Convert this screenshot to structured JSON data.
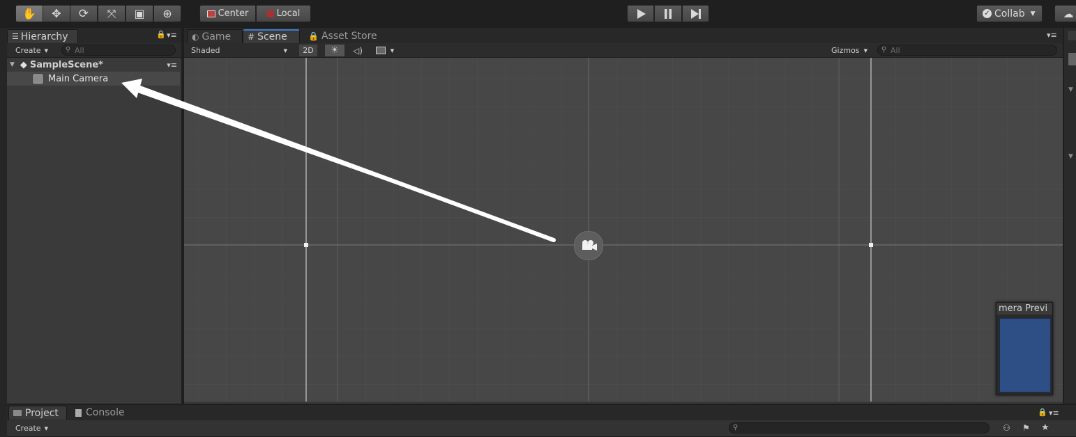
{
  "toolbar": {
    "tools": [
      {
        "icon": "hand-tool-icon",
        "glyph": "✋"
      },
      {
        "icon": "move-tool-icon",
        "glyph": "✥"
      },
      {
        "icon": "rotate-tool-icon",
        "glyph": "⟳"
      },
      {
        "icon": "scale-tool-icon",
        "glyph": "⤧"
      },
      {
        "icon": "rect-tool-icon",
        "glyph": "▣"
      },
      {
        "icon": "transform-tool-icon",
        "glyph": "⊕"
      }
    ],
    "pivot_label": "Center",
    "space_label": "Local",
    "collab_label": "Collab"
  },
  "hierarchy": {
    "tab_label": "Hierarchy",
    "create_label": "Create",
    "search_placeholder": "All",
    "scene_name": "SampleScene*",
    "items": [
      {
        "label": "Main Camera"
      }
    ]
  },
  "scene_view": {
    "tabs": [
      "Game",
      "Scene",
      "Asset Store"
    ],
    "shading_mode": "Shaded",
    "mode_2d_label": "2D",
    "gizmos_label": "Gizmos",
    "search_placeholder": "All",
    "camera_preview_title": "mera Previ"
  },
  "bottom": {
    "tabs": [
      "Project",
      "Console"
    ],
    "create_label": "Create"
  },
  "colors": {
    "accent_tab": "#3d7ccf",
    "preview_fill": "#2e4f86",
    "scene_bg": "#474747"
  }
}
